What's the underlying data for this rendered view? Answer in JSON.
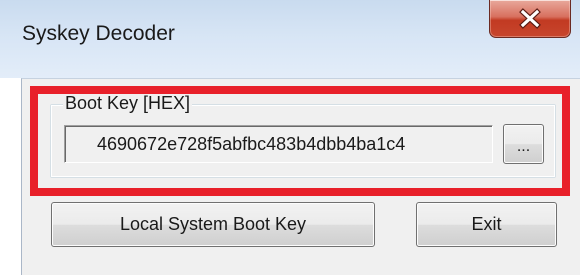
{
  "window": {
    "title": "Syskey Decoder"
  },
  "titlebar": {
    "close_icon": "close-icon"
  },
  "boot_key_group": {
    "label": "Boot Key [HEX]",
    "value": "4690672e728f5abfbc483b4dbb4ba1c4",
    "browse_label": "..."
  },
  "actions": {
    "local_system_boot_key_label": "Local System Boot Key",
    "exit_label": "Exit"
  },
  "colors": {
    "highlight": "#e8202a",
    "close_button": "#c7462d",
    "client_background": "#f0f0f0"
  }
}
